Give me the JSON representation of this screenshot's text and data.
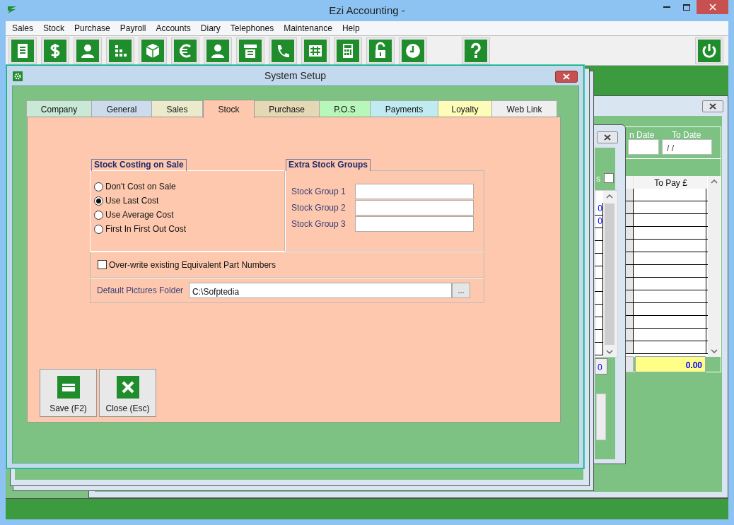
{
  "window": {
    "title": "Ezi Accounting -"
  },
  "menu": [
    "Sales",
    "Stock",
    "Purchase",
    "Payroll",
    "Accounts",
    "Diary",
    "Telephones",
    "Maintenance",
    "Help"
  ],
  "toolbar": [
    {
      "kind": "document"
    },
    {
      "kind": "dollar"
    },
    {
      "kind": "person"
    },
    {
      "kind": "dots"
    },
    {
      "kind": "box"
    },
    {
      "kind": "euro"
    },
    {
      "kind": "person"
    },
    {
      "kind": "register"
    },
    {
      "kind": "phone"
    },
    {
      "kind": "grid"
    },
    {
      "kind": "calculator"
    },
    {
      "kind": "unlock"
    },
    {
      "kind": "clock"
    },
    {
      "kind": "help"
    },
    {
      "kind": "power"
    }
  ],
  "back_window": {
    "from_date_label": "n Date",
    "to_date_label": "To Date",
    "to_date": "/ /",
    "grid_header": "To Pay £",
    "total": "0.00"
  },
  "middle_window": {
    "checkbox_label": "s",
    "checked": false,
    "cells": [
      "0",
      "0"
    ],
    "footer": "0"
  },
  "dialog": {
    "title": "System Setup",
    "tabs": [
      {
        "label": "Company",
        "selected": false,
        "color": "#c9e8d6"
      },
      {
        "label": "General",
        "selected": false,
        "color": "#cddcec"
      },
      {
        "label": "Sales",
        "selected": false,
        "color": "#ebebcc"
      },
      {
        "label": "Stock",
        "selected": true,
        "color": "#fdc8ad"
      },
      {
        "label": "Purchase",
        "selected": false,
        "color": "#e4d9b4"
      },
      {
        "label": "P.O.S",
        "selected": false,
        "color": "#b7f7b9"
      },
      {
        "label": "Payments",
        "selected": false,
        "color": "#c0ebf0"
      },
      {
        "label": "Loyalty",
        "selected": false,
        "color": "#fdfdb9"
      },
      {
        "label": "Web Link",
        "selected": false,
        "color": "#efefef"
      }
    ],
    "costing": {
      "title": "Stock Costing on Sale",
      "options": [
        {
          "label": "Don't Cost on Sale",
          "selected": false
        },
        {
          "label": "Use Last Cost",
          "selected": true
        },
        {
          "label": "Use Average Cost",
          "selected": false
        },
        {
          "label": "First In First Out Cost",
          "selected": false
        }
      ]
    },
    "groups": {
      "title": "Extra Stock Groups",
      "fields": [
        {
          "label": "Stock Group 1"
        },
        {
          "label": "Stock Group 2"
        },
        {
          "label": "Stock Group 3"
        }
      ]
    },
    "overwrite": {
      "label": "Over-write existing Equivalent Part Numbers",
      "checked": false
    },
    "pictures_folder": {
      "label": "Default Pictures Folder",
      "value": "C:\\Sofptedia",
      "browse": "..."
    },
    "buttons": [
      {
        "kind": "save",
        "label": "Save (F2)"
      },
      {
        "kind": "close",
        "label": "Close (Esc)"
      }
    ]
  }
}
